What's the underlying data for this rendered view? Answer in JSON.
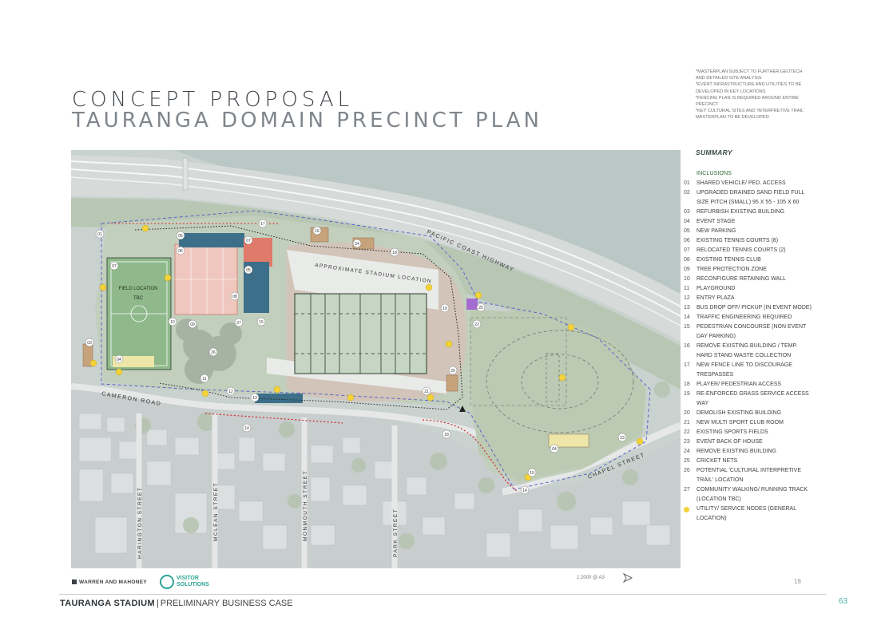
{
  "header": {
    "title_line1": "CONCEPT PROPOSAL",
    "title_line2": "TAURANGA DOMAIN PRECINCT PLAN"
  },
  "notes": [
    "*MASTERPLAN SUBJECT TO FURTHER GEOTECH AND DETAILED SITE ANALYSIS",
    "*EVENT INFRASTRUCTURE AND UTILITIES TO BE DEVELOPED IN KEY LOCATIONS",
    "*FENCING PLAN IS REQUIRED AROUND ENTIRE PRECINCT",
    "*KEY CULTURAL SITES AND 'INTERPRETIVE TRAIL' MASTERPLAN TO BE DEVELOPED"
  ],
  "map": {
    "labels": {
      "pacific_coast_highway": "PACIFIC COAST HIGHWAY",
      "stadium": "APPROXIMATE STADIUM LOCATION",
      "field_location": "FIELD LOCATION",
      "tbc": "TBC",
      "cameron_road": "CAMERON ROAD",
      "chapel_street": "CHAPEL STREET",
      "harington_street": "HARINGTON STREET",
      "mclean_street": "MCLEAN STREET",
      "monmouth_street": "MONMOUTH STREET",
      "park_street": "PARK STREET"
    }
  },
  "summary": {
    "title": "SUMMARY",
    "inclusions_label": "INCLUSIONS",
    "items": [
      {
        "num": "01",
        "text": "SHARED VEHICLE/ PED. ACCESS"
      },
      {
        "num": "02",
        "text": "UPGRADED DRAINED SAND FIELD FULL SIZE PITCH (SMALL) 95 X 55 - 105 X 60"
      },
      {
        "num": "03",
        "text": "REFURBISH EXISTING BUILDING"
      },
      {
        "num": "04",
        "text": "EVENT STAGE"
      },
      {
        "num": "05",
        "text": "NEW PARKING"
      },
      {
        "num": "06",
        "text": "EXISTING TENNIS COURTS (8)"
      },
      {
        "num": "07",
        "text": "RELOCATED TENNIS COURTS (2)"
      },
      {
        "num": "08",
        "text": "EXISTING TENNIS CLUB"
      },
      {
        "num": "09",
        "text": "TREE PROTECTION ZONE"
      },
      {
        "num": "10",
        "text": "RECONFIGURE RETAINING WALL"
      },
      {
        "num": "11",
        "text": "PLAYGROUND"
      },
      {
        "num": "12",
        "text": "ENTRY PLAZA"
      },
      {
        "num": "13",
        "text": "BUS DROP OFF/ PICKUP (IN EVENT MODE)"
      },
      {
        "num": "14",
        "text": "TRAFFIC ENGINEERING REQUIRED"
      },
      {
        "num": "15",
        "text": "PEDESTRIAN CONCOURSE (NON EVENT DAY PARKING)"
      },
      {
        "num": "16",
        "text": "REMOVE EXISTING BUILDING / TEMP. HARD STAND WASTE COLLECTION"
      },
      {
        "num": "17",
        "text": "NEW FENCE LINE TO DISCOURAGE TRESPASSES"
      },
      {
        "num": "18",
        "text": "PLAYER/ PEDESTRIAN ACCESS"
      },
      {
        "num": "19",
        "text": "RE-ENFORCED GRASS SERVICE ACCESS WAY"
      },
      {
        "num": "20",
        "text": "DEMOLISH EXISTING BUILDING"
      },
      {
        "num": "21",
        "text": "NEW MULTI SPORT CLUB ROOM"
      },
      {
        "num": "22",
        "text": "EXISTING SPORTS FIELDS"
      },
      {
        "num": "23",
        "text": "EVENT BACK OF HOUSE"
      },
      {
        "num": "24",
        "text": "REMOVE EXISTING BUILDING"
      },
      {
        "num": "25",
        "text": "CRICKET NETS"
      },
      {
        "num": "26",
        "text": "POTENTIAL 'CULTURAL INTERPRETIVE TRAIL' LOCATION"
      },
      {
        "num": "27",
        "text": "COMMUNITY WALKING/ RUNNING TRACK (LOCATION TBC)"
      }
    ],
    "utility_text": "UTILITY/ SERVICE NODES (GENERAL LOCATION)",
    "utility_color": "#f3d23a"
  },
  "doc_footer": {
    "logo_warren": "WARREN AND MAHONEY",
    "logo_visitor_line1": "VISITOR",
    "logo_visitor_line2": "SOLUTIONS",
    "scale": "1:2000 @ A3",
    "inner_page": "18"
  },
  "page_footer": {
    "project": "TAURANGA STADIUM",
    "separator": "|",
    "subtitle": "PRELIMINARY BUSINESS CASE",
    "page_number": "63"
  },
  "colors": {
    "accent_teal": "#2ea596",
    "utility_yellow": "#f3d23a",
    "parking_blue": "#3d6f8a",
    "tennis_red": "#e07a6a"
  }
}
